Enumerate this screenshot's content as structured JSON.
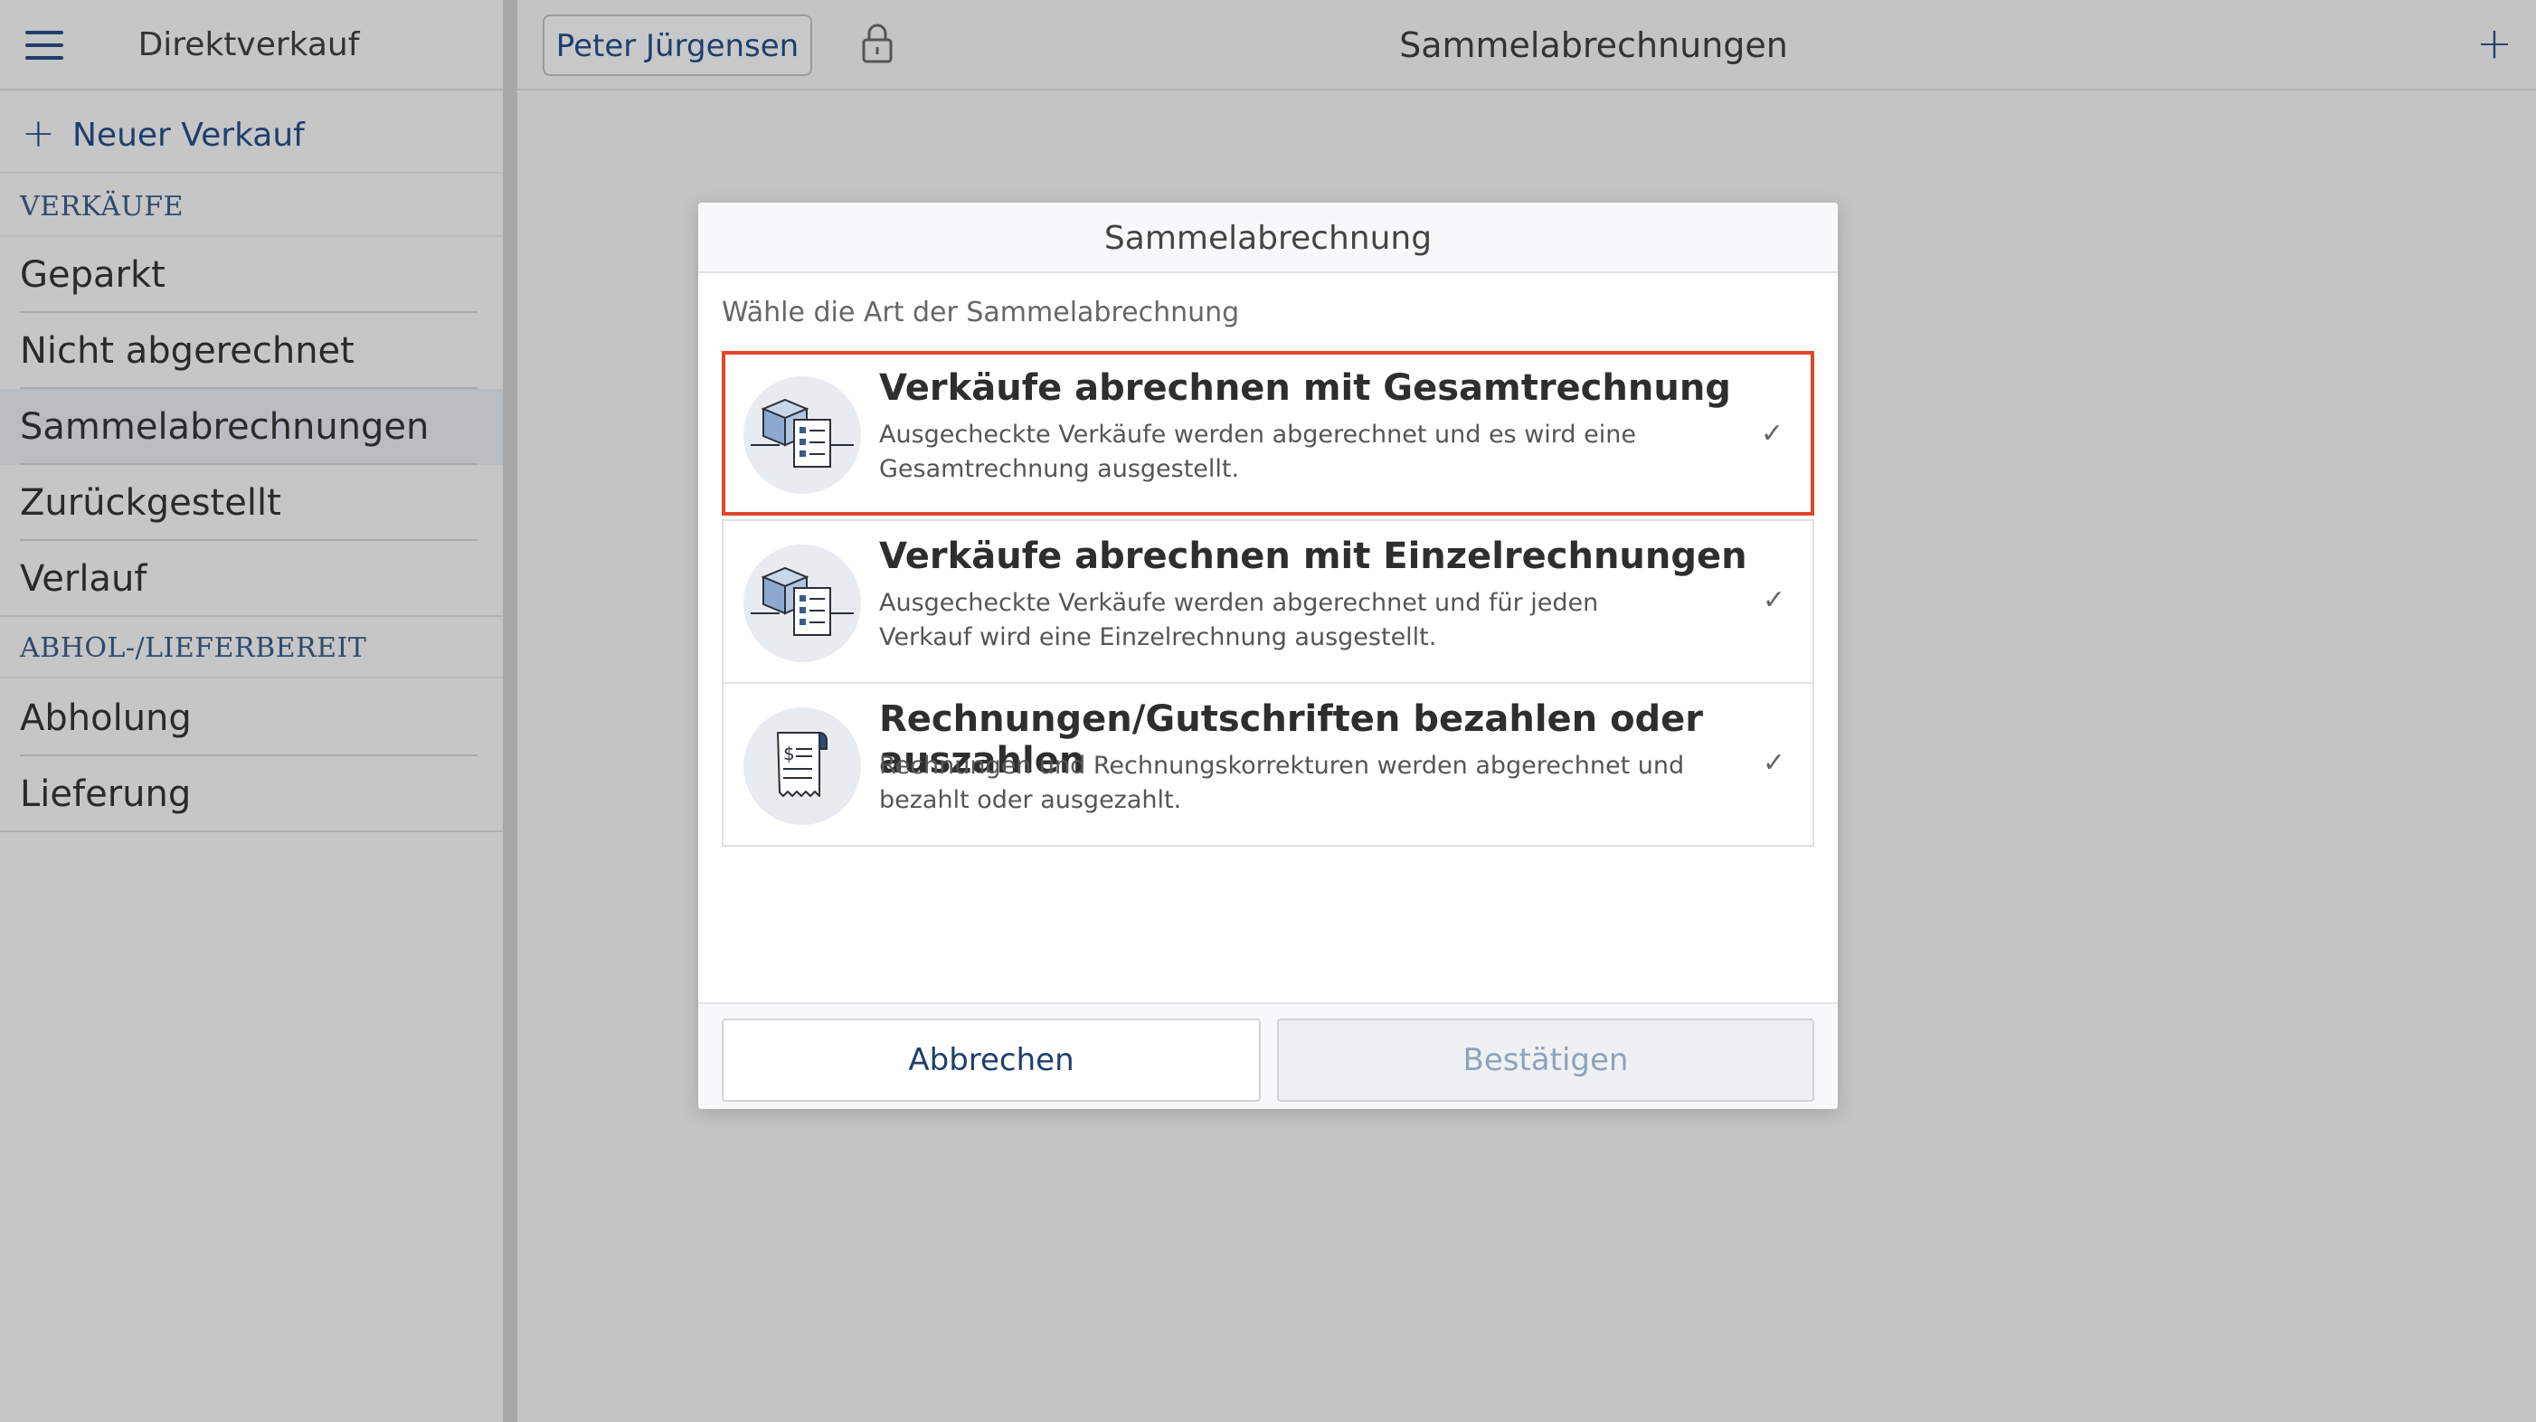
{
  "sidebar": {
    "title": "Direktverkauf",
    "new_sale_label": "Neuer Verkauf",
    "sections": [
      {
        "header": "VERKÄUFE",
        "items": [
          "Geparkt",
          "Nicht abgerechnet",
          "Sammelabrechnungen",
          "Zurückgestellt",
          "Verlauf"
        ]
      },
      {
        "header": "ABHOL-/LIEFERBEREIT",
        "items": [
          "Abholung",
          "Lieferung"
        ]
      }
    ],
    "active_item": "Sammelabrechnungen"
  },
  "topbar": {
    "user_name": "Peter Jürgensen",
    "title": "Sammelabrechnungen",
    "add_label": "+"
  },
  "dialog": {
    "title": "Sammelabrechnung",
    "subtitle": "Wähle die Art der Sammelabrechnung",
    "options": [
      {
        "title": "Verkäufe abrechnen mit Gesamtrechnung",
        "description": "Ausgecheckte Verkäufe werden abgerechnet und es wird eine Gesamtrechnung ausgestellt.",
        "icon": "package-invoice-icon",
        "check": "✓"
      },
      {
        "title": "Verkäufe abrechnen mit Einzelrechnungen",
        "description": "Ausgecheckte Verkäufe werden abgerechnet und für jeden Verkauf wird eine Einzelrechnung ausgestellt.",
        "icon": "package-invoice-icon",
        "check": "✓"
      },
      {
        "title": "Rechnungen/Gutschriften bezahlen oder auszahlen",
        "description": "Rechnungen und Rechnungskorrekturen werden abgerechnet und bezahlt oder ausgezahlt.",
        "icon": "receipt-icon",
        "check": "✓"
      }
    ],
    "selected_option": 0,
    "cancel_label": "Abbrechen",
    "confirm_label": "Bestätigen"
  },
  "colors": {
    "accent": "#1e3f6e",
    "selection_border": "#e2452b",
    "overlay": "#c4c4c4"
  }
}
